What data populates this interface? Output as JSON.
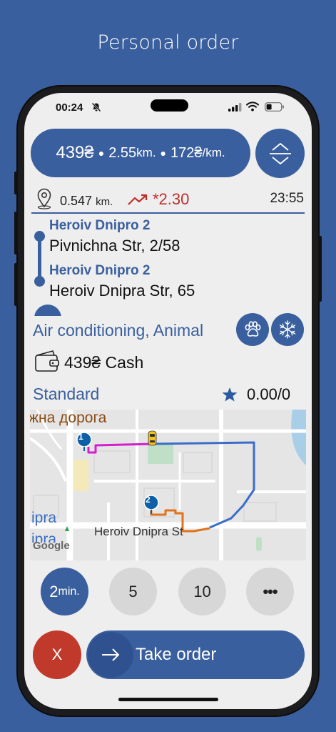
{
  "page": {
    "heading": "Personal order"
  },
  "status_bar": {
    "time": "00:24"
  },
  "summary": {
    "price": "439₴",
    "distance": "2.55",
    "distance_unit": "km.",
    "rate": "172₴",
    "rate_unit": "/km."
  },
  "pickup": {
    "distance": "0.547",
    "unit": "km.",
    "surge": "*2.30",
    "time": "23:55"
  },
  "route": {
    "stops": [
      {
        "number": "1",
        "district": "Heroiv Dnipro 2",
        "street": "Pivnichna Str, 2/58"
      },
      {
        "number": "2",
        "district": "Heroiv Dnipro 2",
        "street": "Heroiv Dnipra Str, 65"
      }
    ]
  },
  "options": {
    "text": "Air conditioning, Animal"
  },
  "payment": {
    "text": "439₴ Cash"
  },
  "tariff": {
    "name": "Standard",
    "rating": "0.00/0"
  },
  "map": {
    "labels": {
      "road_top": "жна дорога",
      "street": "Heroiv Dnipra St",
      "left_top": "ipra",
      "left_bottom": "ipra",
      "logo": "Google"
    },
    "colors": {
      "pickup_route": "#d21fd0",
      "main_route": "#3b6dc8",
      "trip_route": "#e0731c"
    }
  },
  "eta_buttons": [
    {
      "value": "2",
      "unit": "min."
    },
    {
      "value": "5"
    },
    {
      "value": "10"
    },
    {
      "value": "•••"
    }
  ],
  "actions": {
    "reject": "X",
    "take": "Take order"
  },
  "colors": {
    "brand": "#3a5f9e",
    "reject": "#c0392b",
    "surge": "#c0302b"
  }
}
